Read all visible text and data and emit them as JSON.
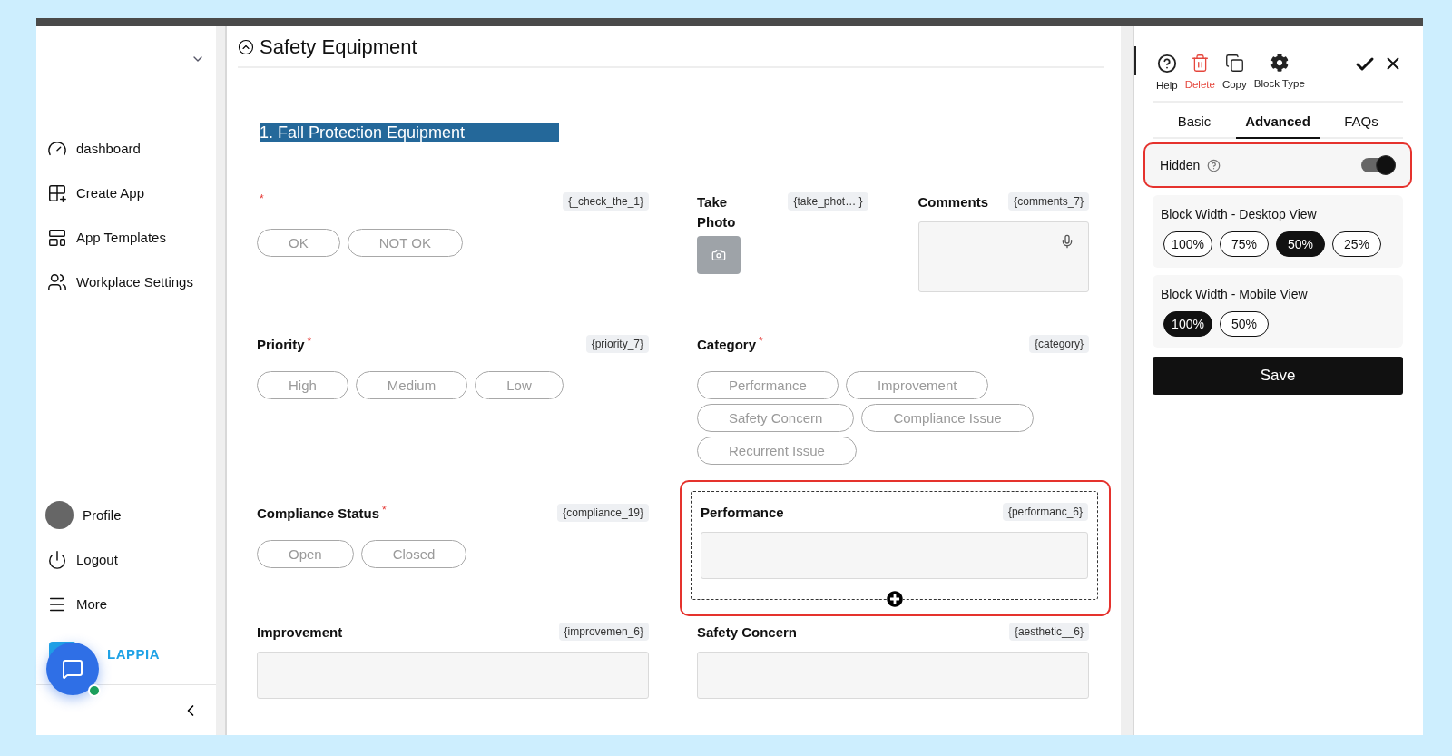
{
  "sidebar": {
    "items": [
      {
        "label": "dashboard"
      },
      {
        "label": "Create App"
      },
      {
        "label": "App Templates"
      },
      {
        "label": "Workplace Settings"
      }
    ],
    "bottom_items": [
      {
        "label": "Profile"
      },
      {
        "label": "Logout"
      },
      {
        "label": "More"
      }
    ],
    "logo": "LAPPIA"
  },
  "section": {
    "title": "Safety Equipment",
    "subsection": "1. Fall Protection Equipment"
  },
  "rows": [
    [
      [
        {
          "kind": "choice",
          "required_mark": "*",
          "variable": "{_check_the_1}",
          "options": [
            "OK",
            "NOT OK"
          ],
          "selected": false
        }
      ],
      [
        {
          "kind": "photo",
          "label": "Take Photo",
          "variable": "{take_phot… }",
          "selected": false
        },
        {
          "kind": "text",
          "label": "Comments",
          "variable": "{comments_7}",
          "voice": true,
          "selected": false
        }
      ]
    ],
    [
      [
        {
          "kind": "choice",
          "label": "Priority",
          "required_mark": "*",
          "variable": "{priority_7}",
          "options": [
            "High",
            "Medium",
            "Low"
          ],
          "selected": false
        }
      ],
      [
        {
          "kind": "choice",
          "label": "Category",
          "required_mark": "*",
          "variable": "{category}",
          "options": [
            "Performance",
            "Improvement",
            "Safety Concern",
            "Compliance Issue",
            "Recurrent Issue"
          ],
          "selected": false
        }
      ]
    ],
    [
      [
        {
          "kind": "choice",
          "label": "Compliance Status",
          "required_mark": "*",
          "variable": "{compliance_19}",
          "options": [
            "Open",
            "Closed"
          ],
          "selected": false
        }
      ],
      [
        {
          "kind": "text",
          "label": "Performance",
          "variable": "{performanc_6}",
          "voice": false,
          "selected": true
        }
      ]
    ],
    [
      [
        {
          "kind": "text",
          "label": "Improvement",
          "variable": "{improvemen_6}",
          "voice": false,
          "selected": false
        }
      ],
      [
        {
          "kind": "text",
          "label": "Safety Concern",
          "variable": "{aesthetic__6}",
          "voice": false,
          "selected": false
        }
      ]
    ]
  ],
  "panel": {
    "toolbar": [
      {
        "label": "Help",
        "kind": "help"
      },
      {
        "label": "Delete",
        "kind": "delete"
      },
      {
        "label": "Copy",
        "kind": "copy"
      },
      {
        "label": "Block Type",
        "kind": "gear"
      }
    ],
    "tabs": [
      {
        "label": "Basic",
        "selected": false
      },
      {
        "label": "Advanced",
        "selected": true
      },
      {
        "label": "FAQs",
        "selected": false
      }
    ],
    "hidden": {
      "label": "Hidden",
      "on": true
    },
    "width_groups": [
      {
        "label": "Block Width - Desktop View",
        "options": [
          {
            "label": "100%",
            "selected": false
          },
          {
            "label": "75%",
            "selected": false
          },
          {
            "label": "50%",
            "selected": true
          },
          {
            "label": "25%",
            "selected": false
          }
        ]
      },
      {
        "label": "Block Width - Mobile View",
        "options": [
          {
            "label": "100%",
            "selected": true
          },
          {
            "label": "50%",
            "selected": false
          }
        ]
      }
    ],
    "save": "Save"
  }
}
